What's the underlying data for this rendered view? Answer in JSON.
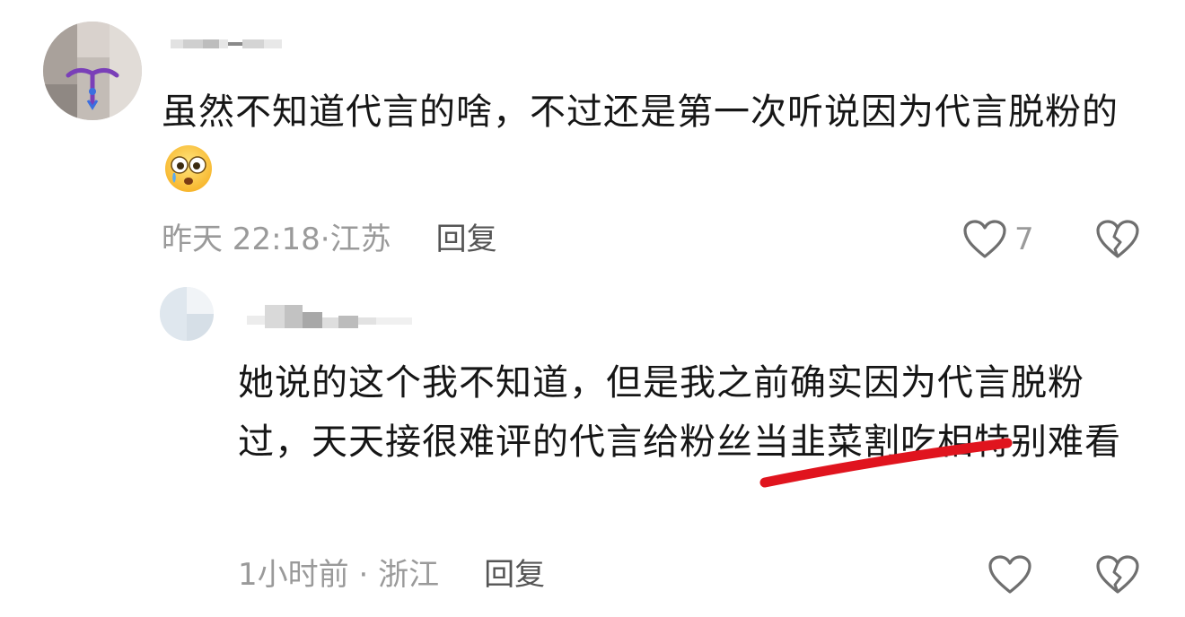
{
  "comments": [
    {
      "text": "虽然不知道代言的啥，不过还是第一次听说因为代言脱粉的",
      "time": "昨天 22:18",
      "location": "江苏",
      "reply_label": "回复",
      "likes": "7",
      "emoji": "flushed-crying-face-emoji"
    },
    {
      "text": "她说的这个我不知道，但是我之前确实因为代言脱粉过，天天接很难评的代言给粉丝当韭菜割吃相特别难看",
      "time": "1小时前",
      "location": "浙江",
      "reply_label": "回复"
    }
  ],
  "icons": {
    "like": "heart-outline-icon",
    "dislike": "broken-heart-icon"
  },
  "colors": {
    "text": "#161616",
    "meta": "#9a9a9a",
    "reply": "#555555",
    "annotation_stroke": "#e0141e"
  }
}
